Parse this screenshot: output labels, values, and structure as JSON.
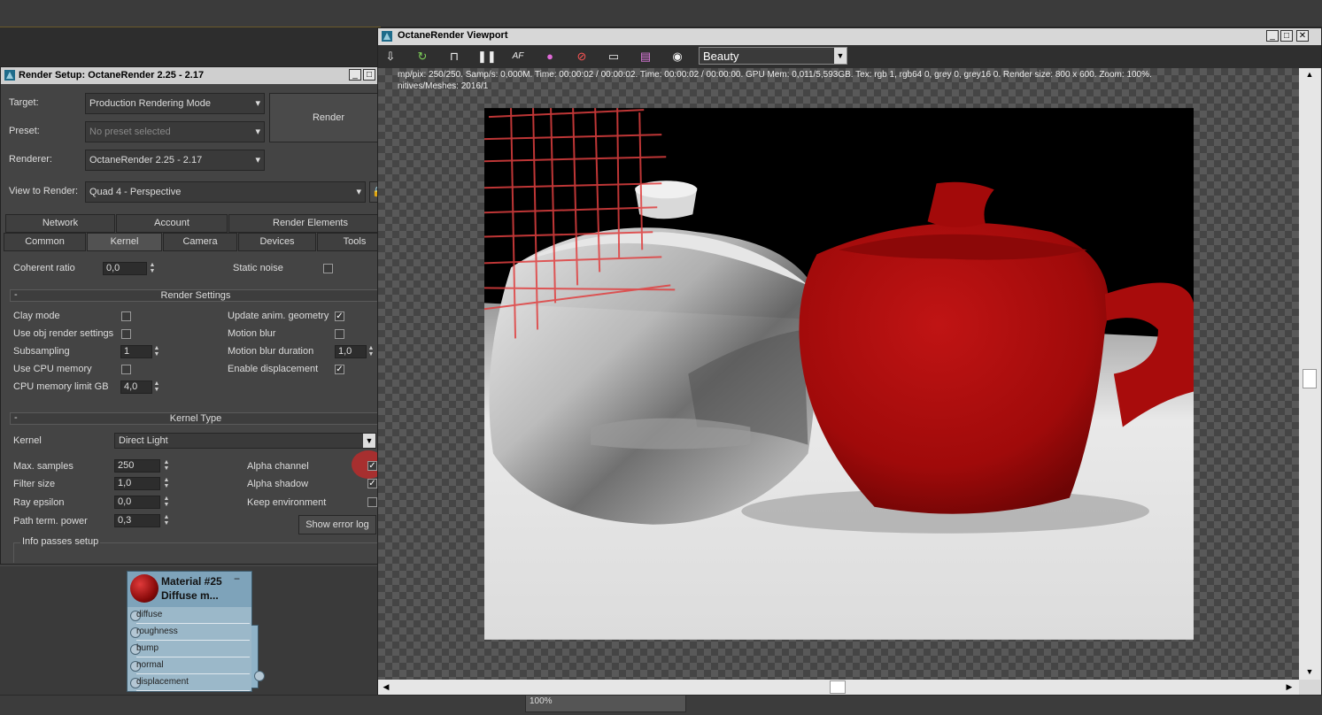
{
  "render_setup": {
    "title": "Render Setup: OctaneRender 2.25 - 2.17",
    "target_label": "Target:",
    "target_value": "Production Rendering Mode",
    "preset_label": "Preset:",
    "preset_value": "No preset selected",
    "renderer_label": "Renderer:",
    "renderer_value": "OctaneRender 2.25 - 2.17",
    "view_label": "View to Render:",
    "view_value": "Quad 4 - Perspective",
    "render_button": "Render",
    "tabs_row1": [
      "Network",
      "Account",
      "Render Elements"
    ],
    "tabs_row2": [
      "Common",
      "Kernel",
      "Camera",
      "Devices",
      "Tools"
    ],
    "active_tab": "Kernel",
    "coherent_ratio_label": "Coherent ratio",
    "coherent_ratio_value": "0,0",
    "static_noise_label": "Static noise",
    "render_settings": {
      "header": "Render Settings",
      "collapse": "-",
      "clay_mode": "Clay mode",
      "use_obj": "Use obj render settings",
      "subsampling": "Subsampling",
      "subsampling_value": "1",
      "use_cpu_memory": "Use CPU memory",
      "cpu_memory_limit": "CPU memory limit GB",
      "cpu_memory_limit_value": "4,0",
      "update_anim": "Update anim. geometry",
      "motion_blur": "Motion blur",
      "motion_blur_duration": "Motion blur duration",
      "motion_blur_duration_value": "1,0",
      "enable_displacement": "Enable displacement"
    },
    "kernel_type": {
      "header": "Kernel Type",
      "collapse": "-",
      "kernel_label": "Kernel",
      "kernel_value": "Direct Light",
      "max_samples": "Max. samples",
      "max_samples_value": "250",
      "filter_size": "Filter size",
      "filter_size_value": "1,0",
      "ray_epsilon": "Ray epsilon",
      "ray_epsilon_value": "0,0",
      "path_term": "Path term. power",
      "path_term_value": "0,3",
      "alpha_channel": "Alpha channel",
      "alpha_shadow": "Alpha shadow",
      "keep_environment": "Keep environment",
      "show_error_log": "Show error log",
      "info_passes": "Info passes setup"
    }
  },
  "material_node": {
    "title_line1": "Material #25",
    "title_line2": "Diffuse m...",
    "collapse": "−",
    "slots": [
      "diffuse",
      "roughness",
      "bump",
      "normal",
      "displacement"
    ]
  },
  "viewport": {
    "title": "OctaneRender Viewport",
    "pass_value": "Beauty",
    "stats_line1": "mp/pix: 250/250.   Samp/s: 0,000M.   Time: 00:00:02 / 00:00:02.   Time: 00:00:02 / 00:00:00.   GPU Mem: 0,011/5,593GB.   Tex: rgb 1, rgb64 0, grey 0, grey16 0.   Render size: 800 x 600.   Zoom: 100%.",
    "stats_line2": "nitives/Meshes: 2016/1",
    "toolbar_icons": [
      "save-icon",
      "refresh-icon",
      "lock-icon",
      "pause-icon",
      "af-icon",
      "color-icon",
      "no-icon",
      "monitor-icon",
      "film-icon",
      "camera-icon"
    ],
    "af_label": "AF"
  },
  "status_bar": {
    "zoom": "100%"
  }
}
